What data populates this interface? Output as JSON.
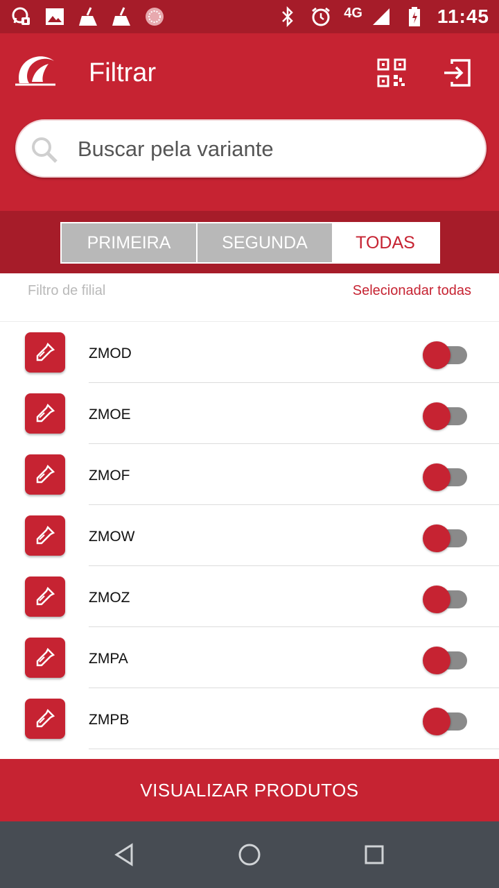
{
  "status_bar": {
    "time": "11:45",
    "network": "4G",
    "left_icons": [
      "whatsapp-icon",
      "gallery-icon",
      "cleaner-icon",
      "cleaner-icon",
      "app-icon"
    ],
    "right_icons": [
      "bluetooth-icon",
      "alarm-icon",
      "signal-icon",
      "battery-icon"
    ]
  },
  "header": {
    "title": "Filtrar",
    "actions": [
      "qr-code-icon",
      "exit-icon"
    ]
  },
  "search": {
    "placeholder": "Buscar pela variante",
    "value": ""
  },
  "tabs": [
    {
      "label": "PRIMEIRA",
      "selected": false
    },
    {
      "label": "SEGUNDA",
      "selected": false
    },
    {
      "label": "TODAS",
      "selected": true
    }
  ],
  "filter": {
    "label": "Filtro de filial",
    "select_all": "Selecionadar todas"
  },
  "items": [
    {
      "label": "ZMOD",
      "icon": "eyedropper-icon",
      "enabled": false
    },
    {
      "label": "ZMOE",
      "icon": "eyedropper-icon",
      "enabled": false
    },
    {
      "label": "ZMOF",
      "icon": "eyedropper-icon",
      "enabled": false
    },
    {
      "label": "ZMOW",
      "icon": "eyedropper-icon",
      "enabled": false
    },
    {
      "label": "ZMOZ",
      "icon": "eyedropper-icon",
      "enabled": false
    },
    {
      "label": "ZMPA",
      "icon": "eyedropper-icon",
      "enabled": false
    },
    {
      "label": "ZMPB",
      "icon": "eyedropper-icon",
      "enabled": false
    }
  ],
  "cta": {
    "label": "VISUALIZAR PRODUTOS"
  },
  "colors": {
    "primary": "#c62332",
    "dark": "#a61c29",
    "navbar": "#474c53"
  }
}
